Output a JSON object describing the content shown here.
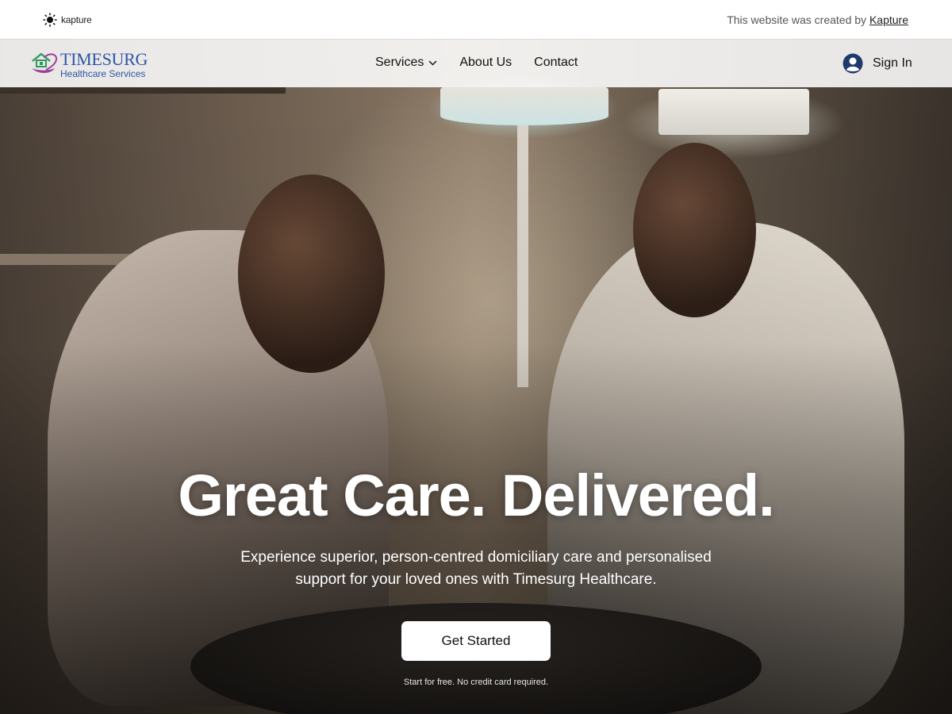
{
  "banner": {
    "brand": "kapture",
    "credit_prefix": "This website was created by ",
    "credit_link": "Kapture"
  },
  "nav": {
    "logo_title": "TIMESURG",
    "logo_subtitle": "Healthcare Services",
    "items": [
      {
        "label": "Services",
        "icon": "chevron-down-icon"
      },
      {
        "label": "About Us"
      },
      {
        "label": "Contact"
      }
    ],
    "signin_label": "Sign In",
    "signin_icon": "user-avatar-icon"
  },
  "hero": {
    "headline": "Great Care. Delivered.",
    "subtext": "Experience superior, person-centred domiciliary care and personalised support for your loved ones with Timesurg Healthcare.",
    "cta_label": "Get Started",
    "note": "Start for free. No credit card required."
  },
  "colors": {
    "brand_blue": "#2e55a6",
    "logo_green": "#2f9a5a",
    "logo_purple": "#9b3f9a",
    "avatar_blue": "#1e3a6b"
  }
}
